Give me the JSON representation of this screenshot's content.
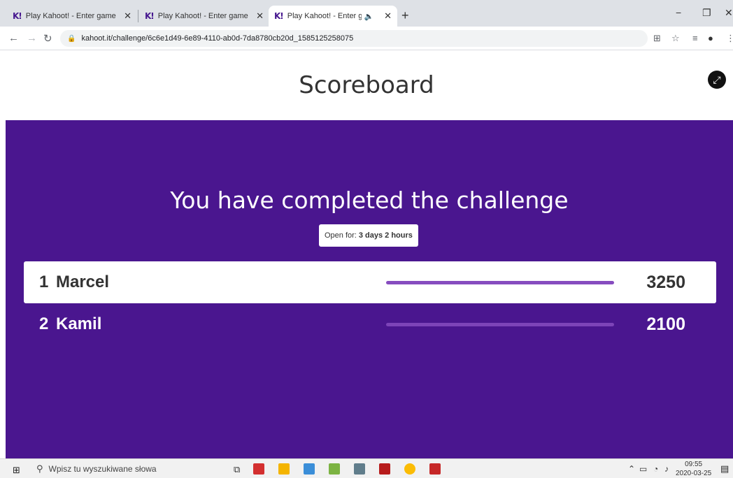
{
  "browser": {
    "tabs": [
      {
        "title": "Play Kahoot! - Enter game PIN he",
        "active": false,
        "audio": false
      },
      {
        "title": "Play Kahoot! - Enter game PIN he",
        "active": false,
        "audio": false
      },
      {
        "title": "Play Kahoot! - Enter game PI",
        "active": true,
        "audio": true
      }
    ],
    "tab_icon": "K!",
    "new_tab": "+",
    "url": "kahoot.it/challenge/6c6e1d49-6e89-4110-ab0d-7da8780cb20d_1585125258075"
  },
  "page": {
    "title": "Scoreboard",
    "headline": "You have completed the challenge",
    "open_for_label": "Open for:",
    "open_for_value": "3 days 2 hours"
  },
  "leaderboard": [
    {
      "rank": "1",
      "name": "Marcel",
      "score": "3250",
      "bar_fraction": 1.0
    },
    {
      "rank": "2",
      "name": "Kamil",
      "score": "2100",
      "bar_fraction": 1.0
    }
  ],
  "taskbar": {
    "search_placeholder": "Wpisz tu wyszukiwane słowa",
    "time": "09:55",
    "date": "2020-03-25"
  },
  "colors": {
    "kahoot_purple": "#4a168f",
    "bar_purple": "#864cbf"
  }
}
